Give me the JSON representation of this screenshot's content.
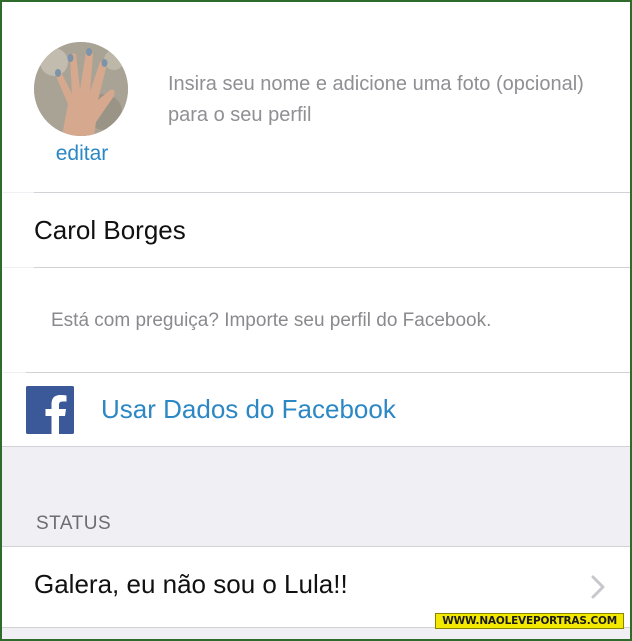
{
  "profile": {
    "edit_label": "editar",
    "hint": "Insira seu nome e adicione uma foto (opcional) para o seu perfil",
    "name_value": "Carol Borges"
  },
  "facebook": {
    "lazy_text": "Está com preguiça? Importe seu perfil do Facebook.",
    "button_label": "Usar Dados do Facebook",
    "icon": "facebook-icon",
    "brand_color": "#3b5998"
  },
  "status": {
    "header": "STATUS",
    "text": "Galera, eu não sou o Lula!!",
    "icon": "chevron-right-icon"
  },
  "watermark": "WWW.NAOLEVEPORTRAS.COM",
  "colors": {
    "accent": "#2c87c5",
    "background": "#efeff4",
    "frame": "#2f6b2a"
  }
}
